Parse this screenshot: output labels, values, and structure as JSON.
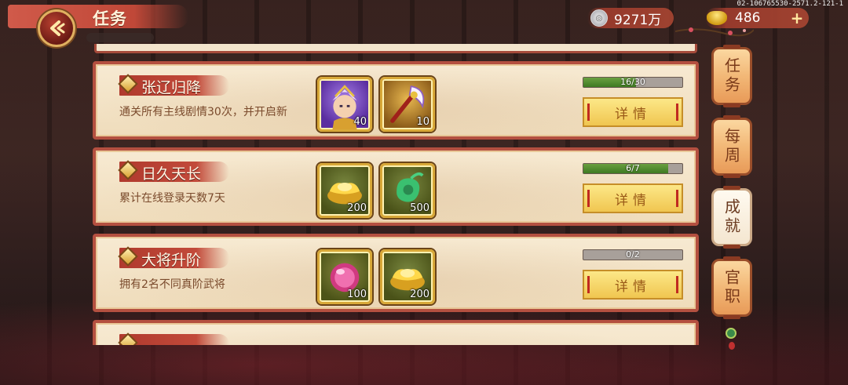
{
  "header": {
    "title": "任务",
    "silver_amount": "9271万",
    "gold_amount": "486",
    "build_id": "02-106765530-2571.2-121-1"
  },
  "tasks": [
    {
      "title": "张辽归降",
      "desc": "通关所有主线剧情30次，并开启新",
      "progress_text": "16/30",
      "progress": 0.5333,
      "button_label": "详情",
      "rewards": [
        {
          "icon": "hero-portrait-icon",
          "count": "40"
        },
        {
          "icon": "weapon-icon",
          "count": "10"
        }
      ]
    },
    {
      "title": "日久天长",
      "desc": "累计在线登录天数7天",
      "progress_text": "6/7",
      "progress": 0.857,
      "button_label": "详情",
      "rewards": [
        {
          "icon": "gold-ingot-icon",
          "count": "200"
        },
        {
          "icon": "jade-icon",
          "count": "500"
        }
      ]
    },
    {
      "title": "大将升阶",
      "desc": "拥有2名不同真阶武将",
      "progress_text": "0/2",
      "progress": 0,
      "button_label": "详情",
      "rewards": [
        {
          "icon": "pink-orb-icon",
          "count": "100"
        },
        {
          "icon": "gold-ingot-icon",
          "count": "200"
        }
      ]
    }
  ],
  "side_tabs": [
    {
      "label": "任务",
      "active": false
    },
    {
      "label": "每周",
      "active": false
    },
    {
      "label": "成就",
      "active": true
    },
    {
      "label": "官职",
      "active": false
    }
  ],
  "colors": {
    "frame_red": "#b45040",
    "progress_green": "#3e7a22",
    "button_gold": "#f0c650"
  }
}
